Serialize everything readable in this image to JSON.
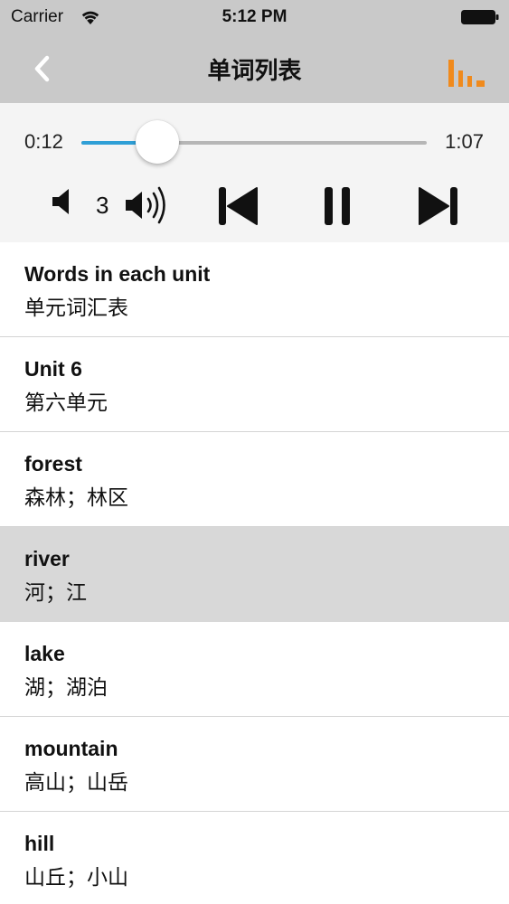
{
  "status_bar": {
    "carrier": "Carrier",
    "time": "5:12 PM",
    "icons": [
      "wifi-icon",
      "battery-icon"
    ]
  },
  "nav": {
    "title": "单词列表",
    "back_icon": "chevron-left-icon",
    "stats_icon": "bar-chart-icon"
  },
  "player": {
    "current_time": "0:12",
    "total_time": "1:07",
    "progress_fraction": 0.22,
    "volume_level": "3",
    "icons": [
      "volume-down-icon",
      "volume-up-icon",
      "skip-previous-icon",
      "pause-icon",
      "skip-next-icon"
    ]
  },
  "words": [
    {
      "en": "Words in each unit",
      "cn": "单元词汇表",
      "selected": false
    },
    {
      "en": "Unit 6",
      "cn": "第六单元",
      "selected": false
    },
    {
      "en": "forest",
      "cn": "森林；林区",
      "selected": false
    },
    {
      "en": "river",
      "cn": "河；江",
      "selected": true
    },
    {
      "en": "lake",
      "cn": "湖；湖泊",
      "selected": false
    },
    {
      "en": "mountain",
      "cn": "高山；山岳",
      "selected": false
    },
    {
      "en": "hill",
      "cn": "山丘；小山",
      "selected": false
    }
  ],
  "colors": {
    "nav_background": "#c9c9c9",
    "player_background": "#f4f4f4",
    "progress_accent": "#2f9fd6",
    "stats_icon": "#f08a1c",
    "selected_row": "#d8d8d8"
  }
}
